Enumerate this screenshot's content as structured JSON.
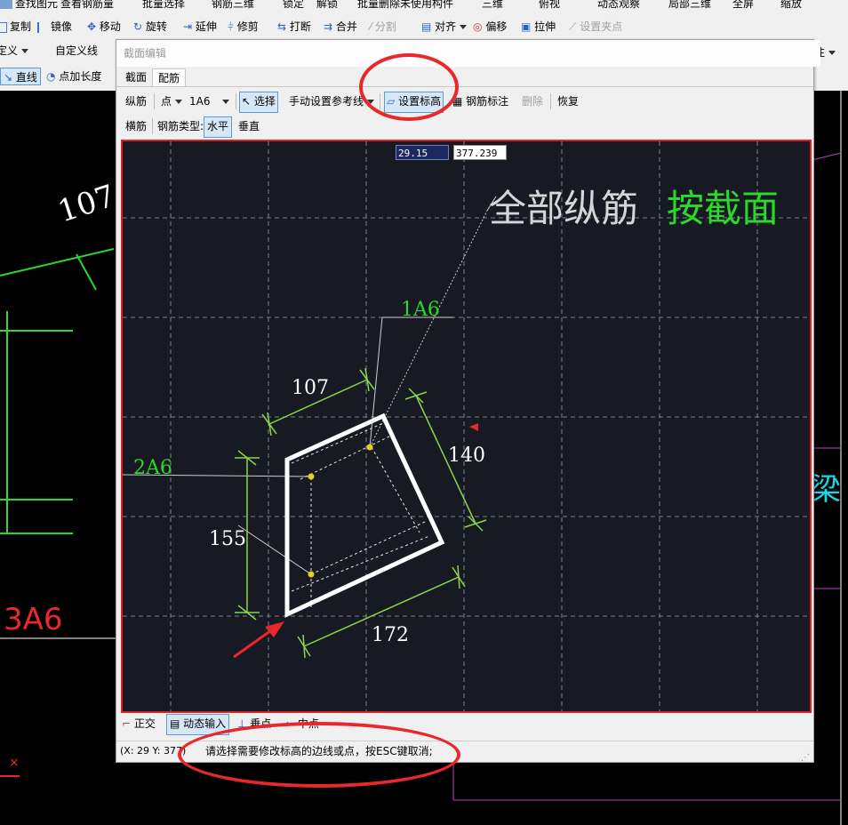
{
  "toolbar_top": {
    "row1": [
      "查找图元",
      "查看钢筋量",
      "批量选择",
      "钢筋三维",
      "锁定",
      "解锁",
      "批量删除未使用构件",
      "三维",
      "俯视",
      "动态观察",
      "局部三维",
      "全屏",
      "缩放"
    ],
    "row2": [
      "复制",
      "镜像",
      "移动",
      "旋转",
      "延伸",
      "修剪",
      "打断",
      "合并",
      "分割",
      "对齐",
      "偏移",
      "拉伸",
      "设置夹点"
    ]
  },
  "left_toolbar": {
    "combo1": "定义",
    "combo2": "自定义线",
    "line_button": "直线",
    "add_length_button": "点加长度"
  },
  "right_strip": {
    "label": "注"
  },
  "background": {
    "label_107": "107",
    "label_3a6": "3A6",
    "label_beam": "梁"
  },
  "dialog": {
    "title": "截面编辑",
    "tabs": [
      "截面",
      "配筋"
    ],
    "toolbar1": {
      "zongjin": "纵筋",
      "point_combo": "点",
      "bar_combo": "1A6",
      "select": "选择",
      "manual_ref_line": "手动设置参考线",
      "set_elevation": "设置标高",
      "mark": "钢筋标注",
      "delete": "删除",
      "restore": "恢复"
    },
    "toolbar2": {
      "hengjin": "横筋",
      "rebar_type_label": "钢筋类型:",
      "horizontal": "水平",
      "vertical": "垂直"
    },
    "canvas": {
      "input_x": "29.15",
      "input_y": "377.239",
      "overlay_text_white": "全部纵筋",
      "overlay_text_green": "按截面",
      "label_1a6": "1A6",
      "label_2a6": "2A6",
      "dim_107": "107",
      "dim_140": "140",
      "dim_155": "155",
      "dim_172": "172"
    },
    "bottom_toolbar": {
      "ortho": "正交",
      "dynamic_input": "动态输入",
      "perpendicular": "垂点",
      "midpoint": "中点"
    },
    "status": {
      "coords": "(X: 29 Y: 377)",
      "message": "请选择需要修改标高的边线或点，按ESC键取消;"
    }
  },
  "colors": {
    "canvas_bg": "#171a22",
    "green": "#2bd82b",
    "dim_green": "#8cd64a",
    "highlight_red": "#e8282a"
  }
}
